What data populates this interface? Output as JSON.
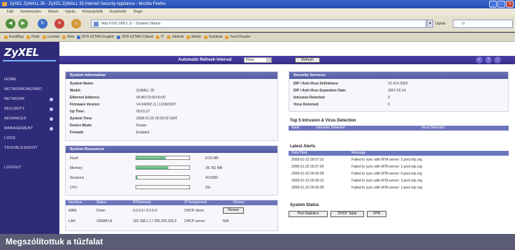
{
  "window": {
    "title": "ZyXEL ZyWALL 35 - ZyXEL ZyWALL 35 Internet Security Appliance - Mozilla Firefox"
  },
  "menubar": {
    "items": [
      "Fájl",
      "Szerkesztés",
      "Nézet",
      "Ugrás",
      "Könyvjelzők",
      "Eszközök",
      "Súgó"
    ]
  },
  "navbar": {
    "address": "http://192.168.1.1/ - System Status",
    "go_label": "Ugrás",
    "search_placeholder": "G"
  },
  "bookmarks": {
    "items": [
      "Kezdőlap",
      "Hírek",
      "Levelek",
      "Web",
      "MTA SZTAKI English",
      "MTA SZTAKI Cikkek",
      "IT",
      "Játékok",
      "Média",
      "Szótárak",
      "Feed Reader"
    ]
  },
  "sidebar": {
    "logo": "ZyXEL",
    "items": [
      {
        "label": "HOME",
        "has_chevron": false
      },
      {
        "label": "NETWORK/WIZARD",
        "has_chevron": false
      },
      {
        "label": "NETWORK",
        "has_chevron": true
      },
      {
        "label": "SECURITY",
        "has_chevron": true
      },
      {
        "label": "ADVANCED",
        "has_chevron": true
      },
      {
        "label": "MANAGEMENT",
        "has_chevron": true
      },
      {
        "label": "LOGS",
        "has_chevron": false
      },
      {
        "label": "TROUBLESHOOT",
        "has_chevron": false
      },
      {
        "label": "LOGOUT",
        "has_chevron": false
      }
    ]
  },
  "topbar": {
    "refresh_label": "Automatic Refresh Interval",
    "refresh_value": "None",
    "refresh_button": "Refresh"
  },
  "system_info": {
    "title": "System Information",
    "rows": [
      {
        "k": "System Name:",
        "v": ""
      },
      {
        "k": "Model:",
        "v": "ZyWALL 35"
      },
      {
        "k": "Ethernet Address:",
        "v": "00:A0:C5:00:00:00"
      },
      {
        "k": "Firmware Version:",
        "v": "V4.04(WZ.1) | 11/06/2007"
      },
      {
        "k": "Up Time:",
        "v": "00:01:27"
      },
      {
        "k": "System Time:",
        "v": "2008-01-22 00:00:00 GMT"
      },
      {
        "k": "Device Mode:",
        "v": "Router"
      },
      {
        "k": "Firewall:",
        "v": "Enabled"
      }
    ]
  },
  "system_resources": {
    "title": "System Resources",
    "rows": [
      {
        "k": "Flash",
        "v": "8.00 MB",
        "fraction": 0.55
      },
      {
        "k": "Memory",
        "v": "28.781 MB",
        "fraction": 0.6
      },
      {
        "k": "Sessions",
        "v": "4/10000",
        "fraction": 0.02
      },
      {
        "k": "CPU",
        "v": "0%",
        "fraction": 0.0
      }
    ]
  },
  "interfaces": {
    "title": "Interface Status",
    "headers": [
      "Interface",
      "Status",
      "IP/Netmask",
      "IP Assignment",
      "Renew"
    ],
    "rows": [
      {
        "name": "WAN",
        "status": "Down",
        "ip": "0.0.0.0 / 0.0.0.0",
        "assign": "DHCP client",
        "action": "Renew"
      },
      {
        "name": "LAN",
        "status": "100M/Full",
        "ip": "192.168.1.1 / 255.255.255.0",
        "assign": "DHCP server",
        "action": "N/A"
      }
    ]
  },
  "security_services": {
    "title": "Security Services",
    "rows": [
      {
        "k": "IDP / Anti-Virus Definitions:",
        "v": "V1.014 3003"
      },
      {
        "k": "IDP / Anti-Virus Expiration Date:",
        "v": "2007-02-14"
      },
      {
        "k": "Intrusion Detected:",
        "v": "0"
      },
      {
        "k": "Virus Detected:",
        "v": "0"
      }
    ]
  },
  "top5": {
    "title": "Top 5 Intrusion & Virus Detection",
    "headers": [
      "Rank",
      "Intrusion Detected",
      "Virus Detected"
    ]
  },
  "alerts": {
    "title": "Latest Alerts",
    "headers": [
      "Date/Time",
      "Message"
    ],
    "rows": [
      {
        "t": "2008-01-22 00:07:10",
        "m": "Failed to sync with MTA server: 2.pool.ntp.org"
      },
      {
        "t": "2008-01-22 00:07:05",
        "m": "Failed to sync with MTA server: 1.pool.ntp.org"
      },
      {
        "t": "2008-01-22 00:06:58",
        "m": "Failed to sync with MTA server: 0.pool.ntp.org"
      },
      {
        "t": "2008-01-22 00:05:10",
        "m": "Failed to sync with MTA server: 2.pool.ntp.org"
      },
      {
        "t": "2008-01-22 00:05:00",
        "m": "Failed to sync with MTA server: 1.pool.ntp.org"
      }
    ]
  },
  "system_status": {
    "title": "System Status",
    "buttons": [
      "Port Statistics",
      "DHCP Table",
      "VPN"
    ]
  },
  "caption": {
    "text": "Megszólítottuk a tűzfalat"
  }
}
